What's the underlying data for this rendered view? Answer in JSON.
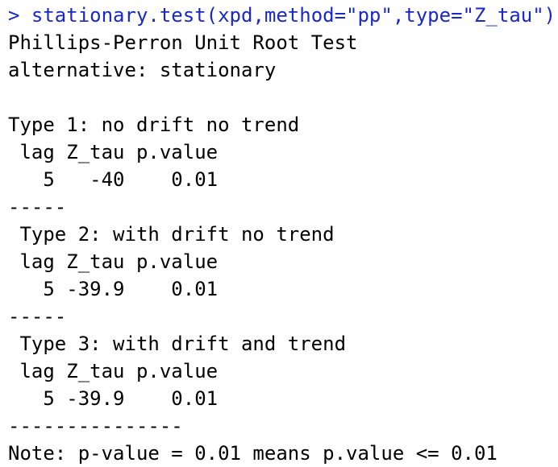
{
  "console": {
    "prompt": "> ",
    "command": "stationary.test(xpd,method=\"pp\",type=\"Z_tau\")",
    "colors": {
      "command": "#1a27c9",
      "output": "#000000",
      "background": "#ffffff"
    },
    "output": [
      "Phillips-Perron Unit Root Test",
      "alternative: stationary",
      "",
      "Type 1: no drift no trend",
      " lag Z_tau p.value",
      "   5   -40    0.01",
      "-----",
      " Type 2: with drift no trend",
      " lag Z_tau p.value",
      "   5 -39.9    0.01",
      "-----",
      " Type 3: with drift and trend",
      " lag Z_tau p.value",
      "   5 -39.9    0.01",
      "---------------",
      "Note: p-value = 0.01 means p.value <= 0.01"
    ]
  }
}
